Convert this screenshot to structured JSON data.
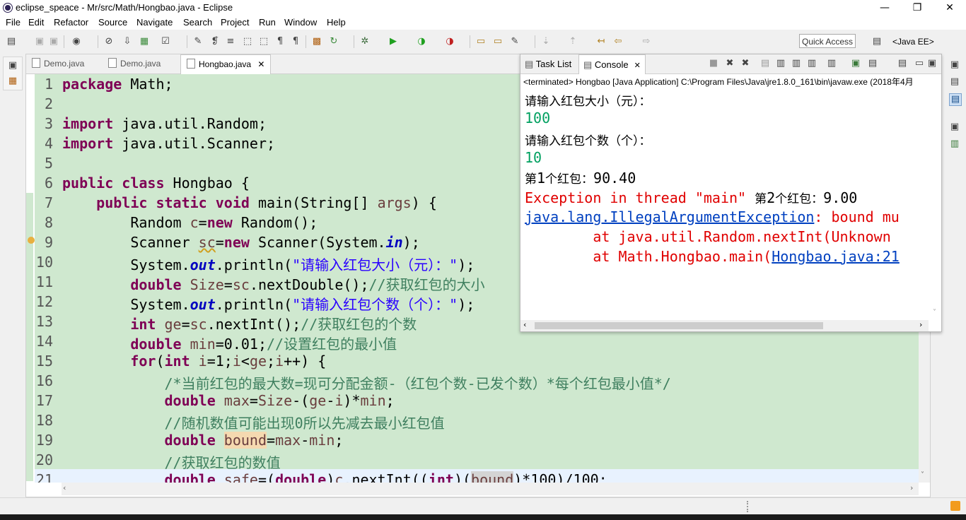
{
  "window": {
    "title": "eclipse_speace - Mr/src/Math/Hongbao.java - Eclipse",
    "minimize": "—",
    "restore": "❐",
    "close": "✕"
  },
  "menu": [
    "File",
    "Edit",
    "Refactor",
    "Source",
    "Navigate",
    "Search",
    "Project",
    "Run",
    "Window",
    "Help"
  ],
  "toolbar": {
    "quick_access_placeholder": "Quick Access",
    "perspective": "<Java EE>"
  },
  "editor": {
    "tabs": [
      {
        "label": "Demo.java"
      },
      {
        "label": "Demo.java"
      },
      {
        "label": "Hongbao.java",
        "active": true
      }
    ],
    "close_glyph": "✕",
    "lines": [
      "1",
      "2",
      "3",
      "4",
      "5",
      "6",
      "7",
      "8",
      "9",
      "10",
      "11",
      "12",
      "13",
      "14",
      "15",
      "16",
      "17",
      "18",
      "19",
      "20",
      "21"
    ],
    "code": {
      "l1_a": "package",
      "l1_b": " Math;",
      "l3_a": "import",
      "l3_b": " java.util.Random;",
      "l4_a": "import",
      "l4_b": " java.util.Scanner;",
      "l6_a": "public",
      "l6_b": " ",
      "l6_c": "class",
      "l6_d": " Hongbao {",
      "l7_a": "    public",
      "l7_b": " ",
      "l7_c": "static",
      "l7_d": " ",
      "l7_e": "void",
      "l7_f": " main(String[] ",
      "l7_g": "args",
      "l7_h": ") {",
      "l8_a": "        Random ",
      "l8_b": "c",
      "l8_c": "=",
      "l8_d": "new",
      "l8_e": " Random();",
      "l9_a": "        Scanner ",
      "l9_b": "sc",
      "l9_c": "=",
      "l9_d": "new",
      "l9_e": " Scanner(System.",
      "l9_f": "in",
      "l9_g": ");",
      "l10_a": "        System.",
      "l10_b": "out",
      "l10_c": ".println(",
      "l10_d": "\"请输入红包大小（元）：\"",
      "l10_e": ");",
      "l11_a": "        ",
      "l11_b": "double",
      "l11_c": " ",
      "l11_d": "Size",
      "l11_e": "=",
      "l11_f": "sc",
      "l11_g": ".nextDouble();",
      "l11_h": "//获取红包的大小",
      "l12_a": "        System.",
      "l12_b": "out",
      "l12_c": ".println(",
      "l12_d": "\"请输入红包个数（个）：\"",
      "l12_e": ");",
      "l13_a": "        ",
      "l13_b": "int",
      "l13_c": " ",
      "l13_d": "ge",
      "l13_e": "=",
      "l13_f": "sc",
      "l13_g": ".nextInt();",
      "l13_h": "//获取红包的个数",
      "l14_a": "        ",
      "l14_b": "double",
      "l14_c": " ",
      "l14_d": "min",
      "l14_e": "=0.01;",
      "l14_f": "//设置红包的最小值",
      "l15_a": "        ",
      "l15_b": "for",
      "l15_c": "(",
      "l15_d": "int",
      "l15_e": " ",
      "l15_f": "i",
      "l15_g": "=1;",
      "l15_h": "i",
      "l15_i": "<",
      "l15_j": "ge",
      "l15_k": ";",
      "l15_l": "i",
      "l15_m": "++) {",
      "l16_a": "            ",
      "l16_b": "/*当前红包的最大数=现可分配金额-（红包个数-已发个数）*每个红包最小值*/",
      "l17_a": "            ",
      "l17_b": "double",
      "l17_c": " ",
      "l17_d": "max",
      "l17_e": "=",
      "l17_f": "Size",
      "l17_g": "-(",
      "l17_h": "ge",
      "l17_i": "-",
      "l17_j": "i",
      "l17_k": ")*",
      "l17_l": "min",
      "l17_m": ";",
      "l18_a": "            ",
      "l18_b": "//随机数值可能出现0所以先减去最小红包值",
      "l19_a": "            ",
      "l19_b": "double",
      "l19_c": " ",
      "l19_d": "bound",
      "l19_e": "=",
      "l19_f": "max",
      "l19_g": "-",
      "l19_h": "min",
      "l19_i": ";",
      "l20_a": "            ",
      "l20_b": "//获取红包的数值",
      "l21_a": "            ",
      "l21_b": "double",
      "l21_c": " ",
      "l21_d": "safe",
      "l21_e": "=(",
      "l21_f": "double",
      "l21_g": ")",
      "l21_h": "c",
      "l21_i": ".nextInt((",
      "l21_j": "int",
      "l21_k": ")(",
      "l21_l": "bound",
      "l21_m": ")*100)/100;"
    }
  },
  "console": {
    "tabs": {
      "task_list": "Task List",
      "console": "Console"
    },
    "header": "<terminated> Hongbao [Java Application] C:\\Program Files\\Java\\jre1.8.0_161\\bin\\javaw.exe (2018年4月",
    "out1": "请输入红包大小（元）：",
    "in1": "100",
    "out2": "请输入红包个数（个）：",
    "in2": "10",
    "out3_a": "第",
    "out3_b": "1",
    "out3_c": "个红包：",
    "out3_d": "90.40",
    "err1": "Exception in thread \"main\" ",
    "out4_a": "第",
    "out4_b": "2",
    "out4_c": "个红包：",
    "out4_d": "9.00",
    "err2_link": "java.lang.IllegalArgumentException",
    "err2_rest": ": bound mu",
    "err3": "        at java.util.Random.nextInt(Unknown ",
    "err4_a": "        at Math.Hongbao.main(",
    "err4_link": "Hongbao.java:21"
  },
  "colors": {
    "editor_bg": "#cfe8cf",
    "keyword": "#7f0055",
    "string": "#2a00ff",
    "comment": "#3f7f5f",
    "error": "#e00000",
    "input": "#00a060"
  }
}
